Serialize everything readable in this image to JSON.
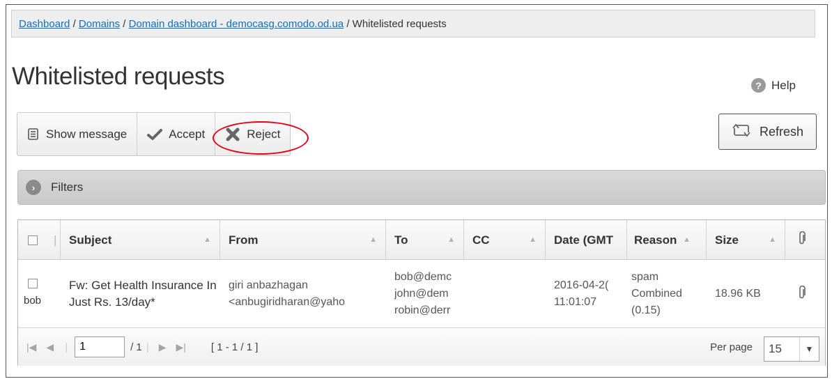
{
  "breadcrumb": {
    "items": [
      "Dashboard",
      "Domains",
      "Domain dashboard - democasg.comodo.od.ua"
    ],
    "current": "Whitelisted requests",
    "sep": "/"
  },
  "page": {
    "title": "Whitelisted requests",
    "help_label": "Help"
  },
  "toolbar": {
    "show_message": "Show message",
    "accept": "Accept",
    "reject": "Reject",
    "refresh": "Refresh"
  },
  "filters": {
    "label": "Filters"
  },
  "table": {
    "columns": [
      "Subject",
      "From",
      "To",
      "CC",
      "Date (GMT",
      "Reason",
      "Size"
    ],
    "row": {
      "user": "bob",
      "subject": "Fw: Get Health Insurance In Just Rs. 13/day*",
      "from_name": "giri anbazhagan",
      "from_email": "<anbugiridharan@yaho",
      "to": [
        "bob@demc",
        "john@dem",
        "robin@derr"
      ],
      "cc": "",
      "date": "2016-04-2(",
      "time": "11:01:07",
      "reason": [
        "spam",
        "Combined",
        "(0.15)"
      ],
      "size": "18.96 KB"
    }
  },
  "pager": {
    "page": "1",
    "of": "/ 1",
    "range": "[ 1 - 1 / 1 ]",
    "per_page_label": "Per page",
    "per_page": "15"
  },
  "colors": {
    "link": "#0b6fc4",
    "highlight_ring": "#e0001a"
  }
}
